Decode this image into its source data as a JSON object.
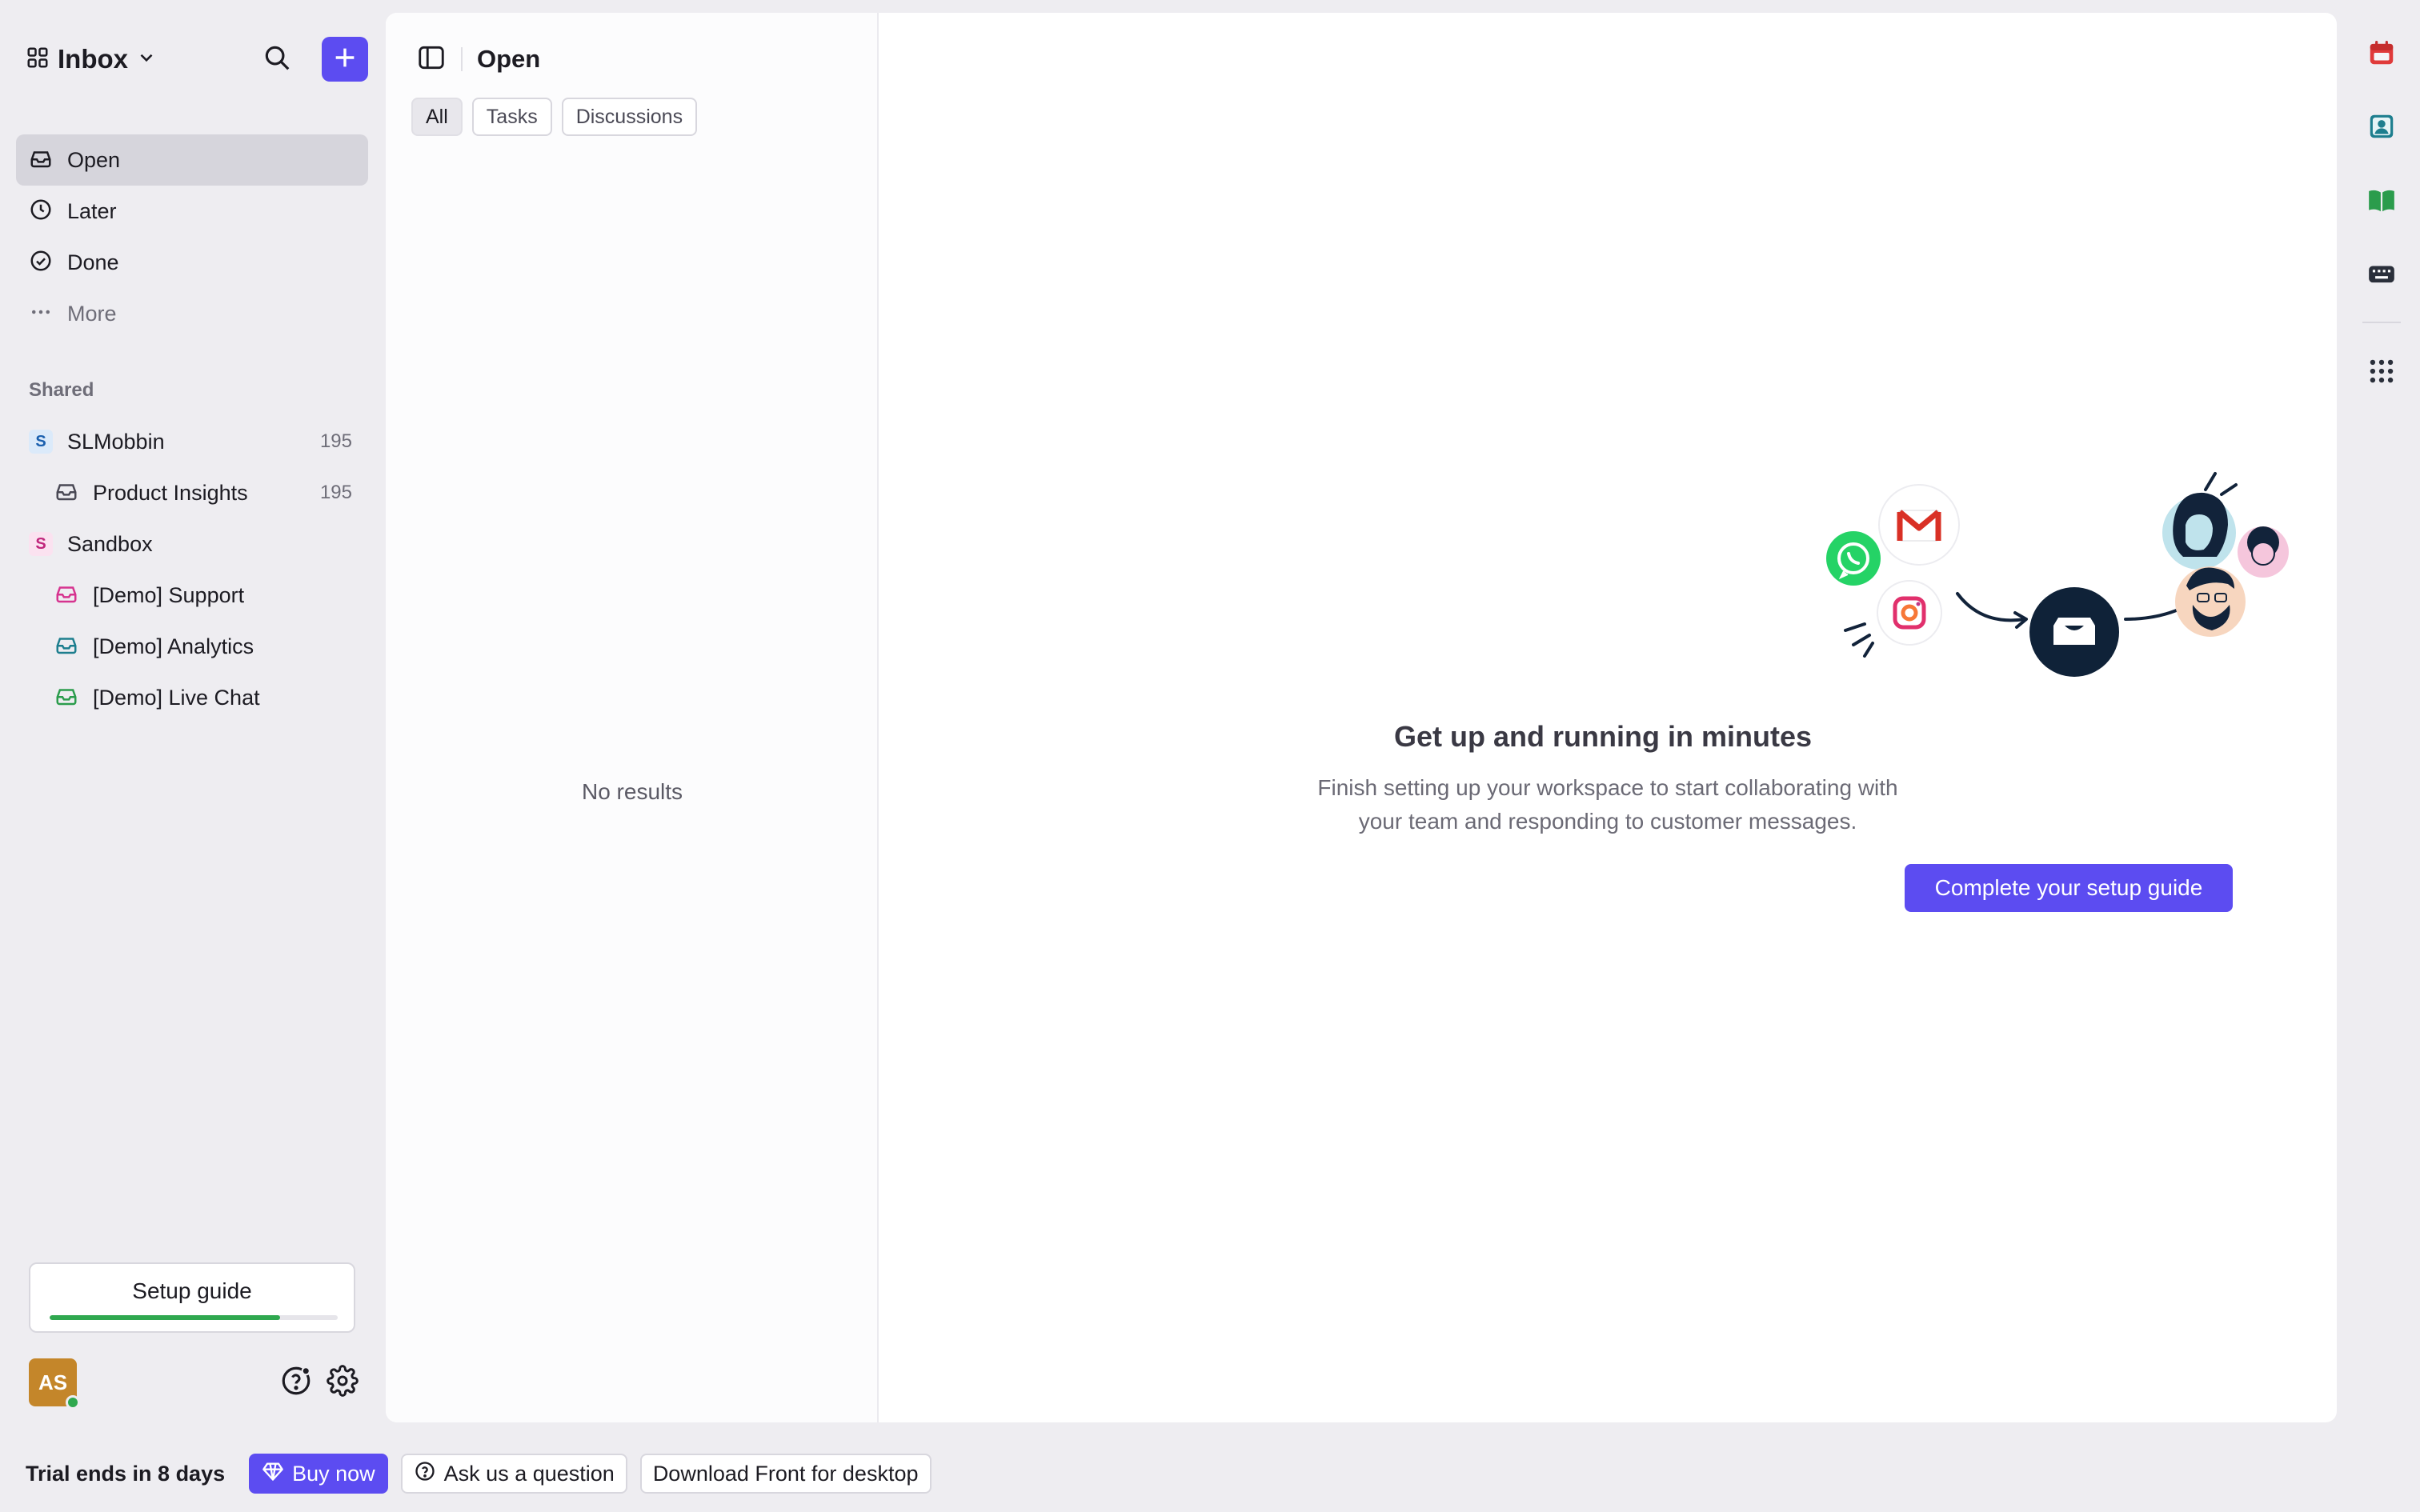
{
  "colors": {
    "accent": "#5c4cf1",
    "success": "#2fa84f",
    "avatar_bg": "#c4862a",
    "calendar_icon": "#e03a3a",
    "contacts_icon": "#1d7e8e",
    "knowledge_icon": "#2b9c4c"
  },
  "sidebar": {
    "inbox_switcher": {
      "label": "Inbox",
      "icon": "grid-icon",
      "chevron": "chevron-down-icon"
    },
    "search_icon": "search-icon",
    "compose_icon": "plus-icon",
    "nav": [
      {
        "label": "Open",
        "icon": "inbox-tray-icon",
        "active": true
      },
      {
        "label": "Later",
        "icon": "clock-icon"
      },
      {
        "label": "Done",
        "icon": "check-circle-icon"
      },
      {
        "label": "More",
        "icon": "ellipsis-icon"
      }
    ],
    "shared_heading": "Shared",
    "shared": [
      {
        "badge": "S",
        "label": "SLMobbin",
        "count": "195"
      },
      {
        "label": "Product Insights",
        "count": "195",
        "icon": "inbox-tray-icon"
      },
      {
        "badge": "S",
        "label": "Sandbox",
        "count": ""
      },
      {
        "label": "[Demo] Support",
        "icon": "inbox-tray-icon",
        "icon_color": "#d6338f"
      },
      {
        "label": "[Demo] Analytics",
        "icon": "inbox-tray-icon",
        "icon_color": "#1d7e8e"
      },
      {
        "label": "[Demo] Live Chat",
        "icon": "inbox-tray-icon",
        "icon_color": "#2b9c4c"
      }
    ],
    "setup_guide": {
      "label": "Setup guide",
      "progress": 0.8
    },
    "user": {
      "initials": "AS",
      "status": "online"
    }
  },
  "list_pane": {
    "title": "Open",
    "filters": [
      "All",
      "Tasks",
      "Discussions"
    ],
    "active_filter": "All",
    "empty_text": "No results"
  },
  "empty_state": {
    "title": "Get up and running in minutes",
    "description_line1": "Finish setting up your workspace to start collaborating with",
    "description_line2": "your team and responding to customer messages.",
    "button_label": "Complete your setup guide"
  },
  "right_rail": [
    "calendar-icon",
    "contacts-icon",
    "book-icon",
    "keyboard-icon",
    "apps-grid-icon"
  ],
  "bottom_bar": {
    "trial_text": "Trial ends in 8 days",
    "buy_label": "Buy now",
    "ask_label": "Ask us a question",
    "download_label": "Download Front for desktop"
  }
}
